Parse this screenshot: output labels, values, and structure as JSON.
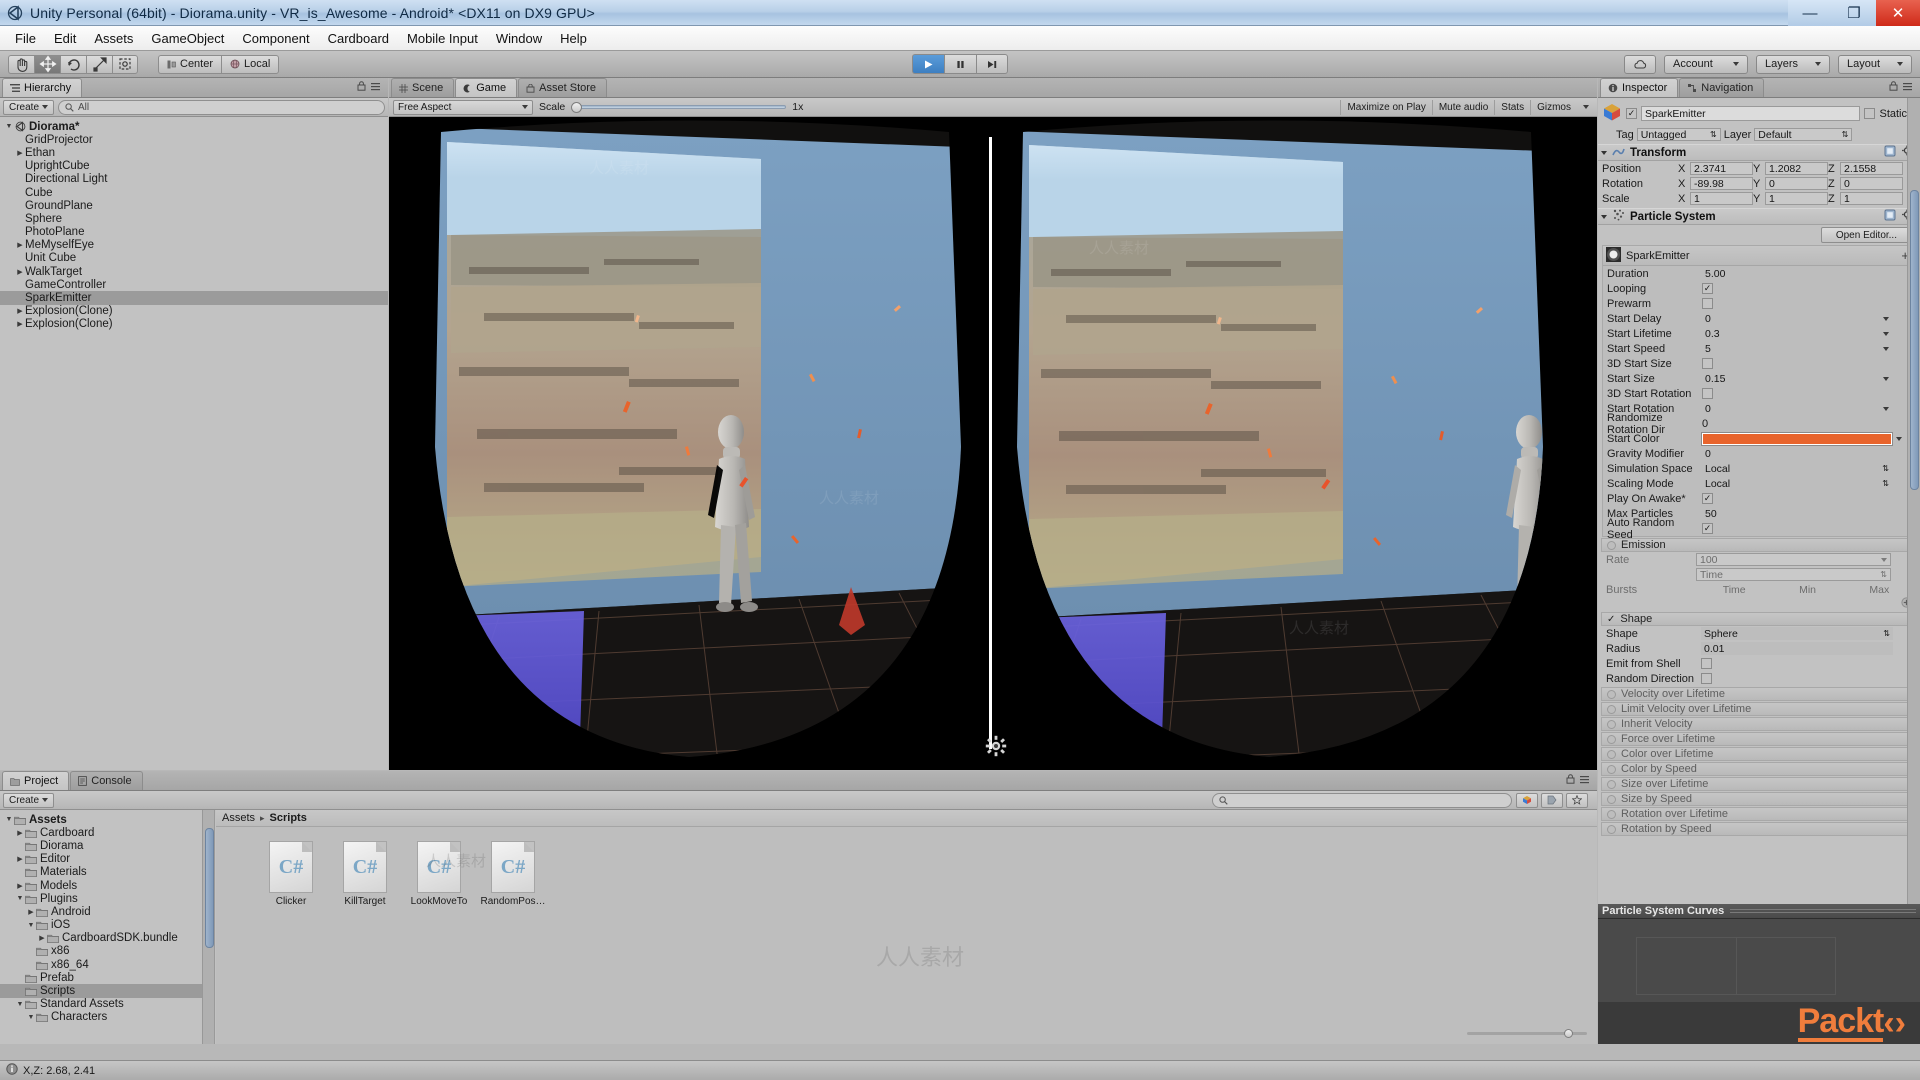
{
  "window": {
    "title": "Unity Personal (64bit) - Diorama.unity - VR_is_Awesome - Android* <DX11 on DX9 GPU>",
    "minimize": "—",
    "maximize": "❐",
    "close": "✕"
  },
  "menu": {
    "items": [
      "File",
      "Edit",
      "Assets",
      "GameObject",
      "Component",
      "Cardboard",
      "Mobile Input",
      "Window",
      "Help"
    ]
  },
  "toolbar": {
    "tools": [
      {
        "name": "hand-tool",
        "glyph": "✋",
        "active": false
      },
      {
        "name": "move-tool",
        "glyph": "✥",
        "active": true
      },
      {
        "name": "rotate-tool",
        "glyph": "↻",
        "active": false
      },
      {
        "name": "scale-tool",
        "glyph": "⤢",
        "active": false
      },
      {
        "name": "rect-tool",
        "glyph": "⧉",
        "active": false
      }
    ],
    "pivot_label": "Center",
    "space_label": "Local",
    "play": "▶",
    "pause": "❙❙",
    "step": "▶❙",
    "cloud_icon": "cloud-icon",
    "account_label": "Account",
    "layers_label": "Layers",
    "layout_label": "Layout"
  },
  "hierarchy": {
    "tab": "Hierarchy",
    "create_label": "Create",
    "search_placeholder": "All",
    "items": [
      {
        "label": "Diorama*",
        "depth": 0,
        "arrow": "down",
        "icon": "scene-icon",
        "selected": false,
        "bold": true
      },
      {
        "label": "GridProjector",
        "depth": 1,
        "arrow": "none",
        "selected": false
      },
      {
        "label": "Ethan",
        "depth": 1,
        "arrow": "right",
        "selected": false
      },
      {
        "label": "UprightCube",
        "depth": 1,
        "arrow": "none",
        "selected": false
      },
      {
        "label": "Directional Light",
        "depth": 1,
        "arrow": "none",
        "selected": false
      },
      {
        "label": "Cube",
        "depth": 1,
        "arrow": "none",
        "selected": false
      },
      {
        "label": "GroundPlane",
        "depth": 1,
        "arrow": "none",
        "selected": false
      },
      {
        "label": "Sphere",
        "depth": 1,
        "arrow": "none",
        "selected": false
      },
      {
        "label": "PhotoPlane",
        "depth": 1,
        "arrow": "none",
        "selected": false
      },
      {
        "label": "MeMyselfEye",
        "depth": 1,
        "arrow": "right",
        "selected": false
      },
      {
        "label": "Unit Cube",
        "depth": 1,
        "arrow": "none",
        "selected": false
      },
      {
        "label": "WalkTarget",
        "depth": 1,
        "arrow": "right",
        "selected": false
      },
      {
        "label": "GameController",
        "depth": 1,
        "arrow": "none",
        "selected": false
      },
      {
        "label": "SparkEmitter",
        "depth": 1,
        "arrow": "none",
        "selected": true
      },
      {
        "label": "Explosion(Clone)",
        "depth": 1,
        "arrow": "right",
        "selected": false
      },
      {
        "label": "Explosion(Clone)",
        "depth": 1,
        "arrow": "right",
        "selected": false
      }
    ]
  },
  "center": {
    "tabs": [
      {
        "label": "Scene",
        "icon": "grid-icon",
        "selected": false
      },
      {
        "label": "Game",
        "icon": "gamepad-icon",
        "selected": true
      },
      {
        "label": "Asset Store",
        "icon": "store-icon",
        "selected": false
      }
    ],
    "aspect": "Free Aspect",
    "scale_label": "Scale",
    "scale_value": "1x",
    "toggles": [
      "Maximize on Play",
      "Mute audio",
      "Stats",
      "Gizmos"
    ],
    "gear_icon": "gear-icon"
  },
  "inspector": {
    "tabs": [
      {
        "label": "Inspector",
        "icon": "info-icon",
        "selected": true
      },
      {
        "label": "Navigation",
        "icon": "navigation-icon",
        "selected": false
      }
    ],
    "object_name": "SparkEmitter",
    "object_enabled": true,
    "static_label": "Static",
    "tag_label": "Tag",
    "tag_value": "Untagged",
    "layer_label": "Layer",
    "layer_value": "Default",
    "transform": {
      "title": "Transform",
      "rows": [
        {
          "label": "Position",
          "x": "2.3741",
          "y": "1.2082",
          "z": "2.1558"
        },
        {
          "label": "Rotation",
          "x": "-89.98",
          "y": "0",
          "z": "0"
        },
        {
          "label": "Scale",
          "x": "1",
          "y": "1",
          "z": "1"
        }
      ],
      "axes": [
        "X",
        "Y",
        "Z"
      ]
    },
    "particle_system": {
      "title": "Particle System",
      "open_editor_label": "Open Editor...",
      "emitter_name": "SparkEmitter",
      "plus_label": "+",
      "start_color_hex": "#e8642c",
      "props": [
        {
          "label": "Duration",
          "type": "text",
          "value": "5.00",
          "flat": true
        },
        {
          "label": "Looping",
          "type": "check",
          "value": true
        },
        {
          "label": "Prewarm",
          "type": "check",
          "value": false
        },
        {
          "label": "Start Delay",
          "type": "dd",
          "value": "0"
        },
        {
          "label": "Start Lifetime",
          "type": "dd",
          "value": "0.3"
        },
        {
          "label": "Start Speed",
          "type": "dd",
          "value": "5"
        },
        {
          "label": "3D Start Size",
          "type": "check",
          "value": false
        },
        {
          "label": "Start Size",
          "type": "dd",
          "value": "0.15"
        },
        {
          "label": "3D Start Rotation",
          "type": "check",
          "value": false
        },
        {
          "label": "Start Rotation",
          "type": "dd",
          "value": "0"
        },
        {
          "label": "Randomize Rotation Dir",
          "type": "inline",
          "value": "0"
        },
        {
          "label": "Start Color",
          "type": "color",
          "value": ""
        },
        {
          "label": "Gravity Modifier",
          "type": "text",
          "value": "0"
        },
        {
          "label": "Simulation Space",
          "type": "sel",
          "value": "Local"
        },
        {
          "label": "Scaling Mode",
          "type": "sel",
          "value": "Local"
        },
        {
          "label": "Play On Awake*",
          "type": "check",
          "value": true
        },
        {
          "label": "Max Particles",
          "type": "text",
          "value": "50"
        },
        {
          "label": "Auto Random Seed",
          "type": "check",
          "value": true
        }
      ],
      "emission": {
        "title": "Emission",
        "rate_label": "Rate",
        "rate_value": "100",
        "rate_mode": "Time",
        "bursts_label": "Bursts",
        "bursts_cols": [
          "Time",
          "Min",
          "Max"
        ]
      },
      "shape": {
        "title": "Shape",
        "enabled": true,
        "rows": [
          {
            "label": "Shape",
            "type": "sel",
            "value": "Sphere"
          },
          {
            "label": "Radius",
            "type": "text",
            "value": "0.01"
          },
          {
            "label": "Emit from Shell",
            "type": "check",
            "value": false
          },
          {
            "label": "Random Direction",
            "type": "check",
            "value": false
          }
        ]
      },
      "modules": [
        "Velocity over Lifetime",
        "Limit Velocity over Lifetime",
        "Inherit Velocity",
        "Force over Lifetime",
        "Color over Lifetime",
        "Color by Speed",
        "Size over Lifetime",
        "Size by Speed",
        "Rotation over Lifetime",
        "Rotation by Speed"
      ]
    },
    "curves_title": "Particle System Curves",
    "brand": "Packt"
  },
  "project": {
    "tabs": [
      {
        "label": "Project",
        "icon": "folder-icon",
        "selected": true
      },
      {
        "label": "Console",
        "icon": "console-icon",
        "selected": false
      }
    ],
    "create_label": "Create",
    "search_placeholder": "",
    "breadcrumb": [
      "Assets",
      "Scripts"
    ],
    "tree": [
      {
        "label": "Assets",
        "depth": 0,
        "arrow": "down",
        "selected": false,
        "bold": true
      },
      {
        "label": "Cardboard",
        "depth": 1,
        "arrow": "right",
        "selected": false
      },
      {
        "label": "Diorama",
        "depth": 1,
        "arrow": "none",
        "selected": false
      },
      {
        "label": "Editor",
        "depth": 1,
        "arrow": "right",
        "selected": false
      },
      {
        "label": "Materials",
        "depth": 1,
        "arrow": "none",
        "selected": false
      },
      {
        "label": "Models",
        "depth": 1,
        "arrow": "right",
        "selected": false
      },
      {
        "label": "Plugins",
        "depth": 1,
        "arrow": "down",
        "selected": false
      },
      {
        "label": "Android",
        "depth": 2,
        "arrow": "right",
        "selected": false
      },
      {
        "label": "iOS",
        "depth": 2,
        "arrow": "down",
        "selected": false
      },
      {
        "label": "CardboardSDK.bundle",
        "depth": 3,
        "arrow": "right",
        "selected": false
      },
      {
        "label": "x86",
        "depth": 2,
        "arrow": "none",
        "selected": false
      },
      {
        "label": "x86_64",
        "depth": 2,
        "arrow": "none",
        "selected": false
      },
      {
        "label": "Prefab",
        "depth": 1,
        "arrow": "none",
        "selected": false
      },
      {
        "label": "Scripts",
        "depth": 1,
        "arrow": "none",
        "selected": true
      },
      {
        "label": "Standard Assets",
        "depth": 1,
        "arrow": "down",
        "selected": false
      },
      {
        "label": "Characters",
        "depth": 2,
        "arrow": "down",
        "selected": false
      }
    ],
    "assets": [
      {
        "label": "Clicker",
        "icon": "csharp-icon"
      },
      {
        "label": "KillTarget",
        "icon": "csharp-icon"
      },
      {
        "label": "LookMoveTo",
        "icon": "csharp-icon"
      },
      {
        "label": "RandomPos…",
        "icon": "csharp-icon"
      }
    ]
  },
  "statusbar": {
    "icon": "info-icon",
    "text": "X,Z: 2.68, 2.41"
  }
}
